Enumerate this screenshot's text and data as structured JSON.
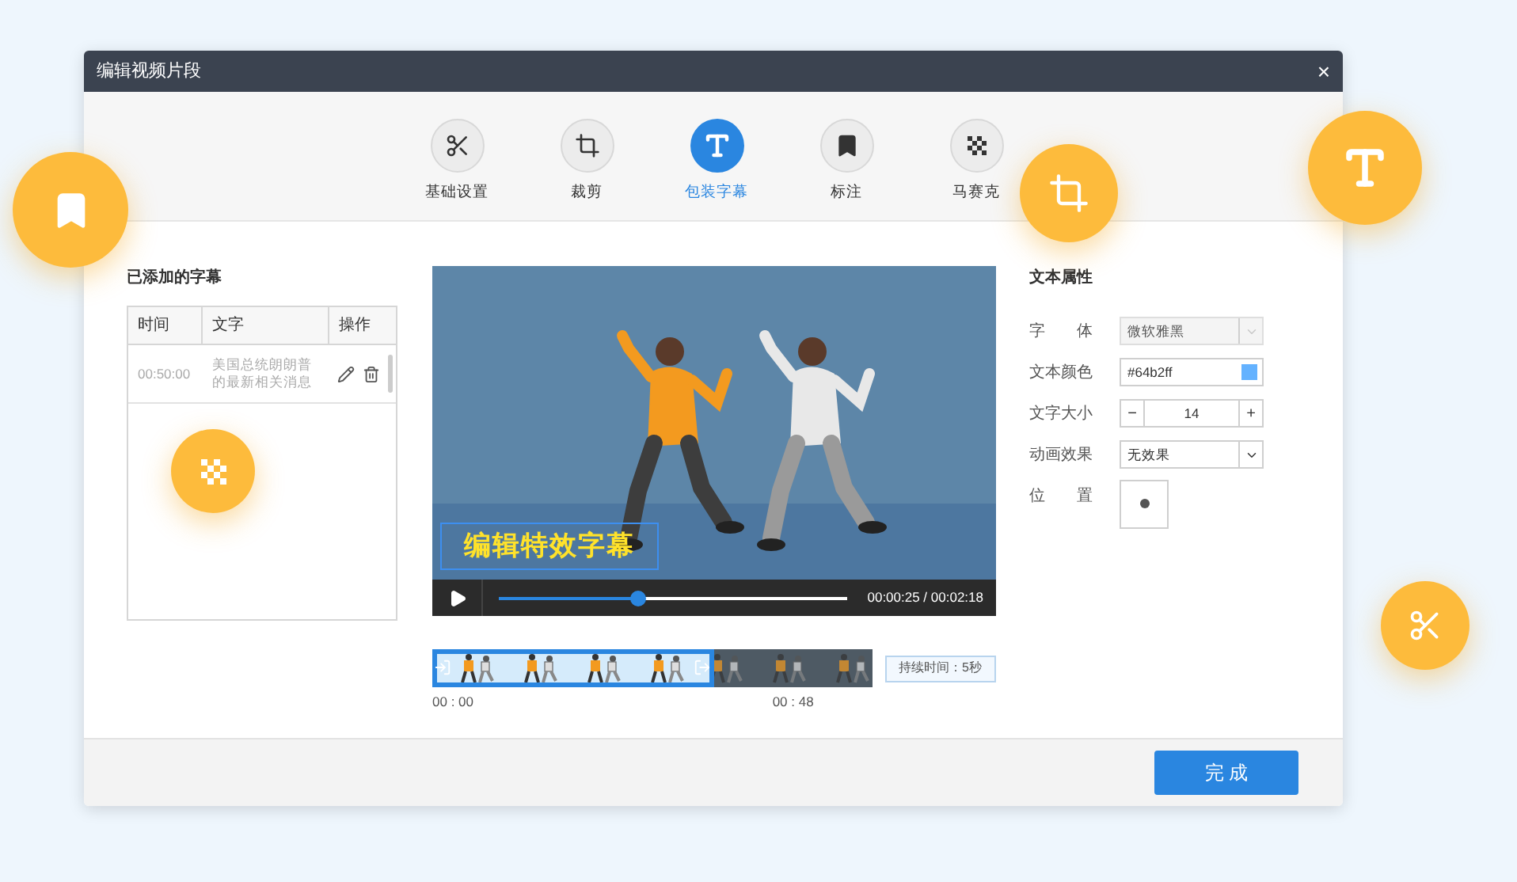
{
  "window": {
    "title": "编辑视频片段",
    "close": "×"
  },
  "toolbar": [
    {
      "label": "基础设置",
      "selected": false
    },
    {
      "label": "裁剪",
      "selected": false
    },
    {
      "label": "包装字幕",
      "selected": true
    },
    {
      "label": "标注",
      "selected": false
    },
    {
      "label": "马赛克",
      "selected": false
    }
  ],
  "subtitles_panel": {
    "title": "已添加的字幕",
    "columns": [
      "时间",
      "文字",
      "操作"
    ],
    "rows": [
      {
        "time": "00:50:00",
        "text": "美国总统朗朗普的最新相关消息"
      }
    ]
  },
  "video": {
    "caption": "编辑特效字幕",
    "time": "00:00:25 / 00:02:18",
    "level": 0.4
  },
  "timeline": {
    "level": 0.64,
    "start": "00 : 00",
    "end": "00 : 48",
    "duration": "持续时间：5秒"
  },
  "text_properties": {
    "title": "文本属性",
    "fields": [
      {
        "kind": "select",
        "label": "字　　体",
        "value": "微软雅黑",
        "disabled": true
      },
      {
        "kind": "color",
        "label": "文本颜色",
        "value": "#64b2ff",
        "color": "#64b2ff"
      },
      {
        "kind": "stepper",
        "label": "文字大小",
        "value": "14",
        "minus": "−",
        "plus": "+"
      },
      {
        "kind": "select",
        "label": "动画效果",
        "value": "无效果",
        "disabled": false
      },
      {
        "kind": "position",
        "label": "位　　置"
      }
    ]
  },
  "footer": {
    "done": "完 成"
  }
}
